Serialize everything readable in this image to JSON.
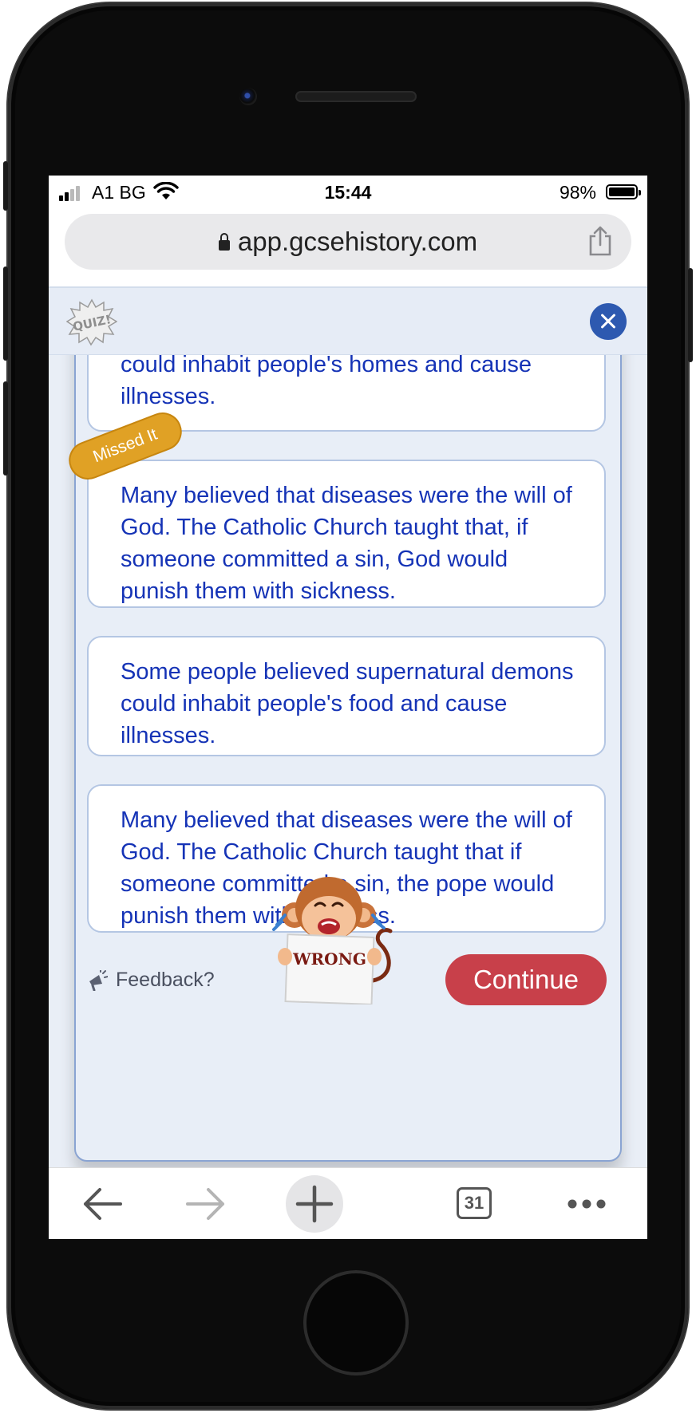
{
  "status_bar": {
    "carrier": "A1 BG",
    "time": "15:44",
    "battery": "98%"
  },
  "browser": {
    "url": "app.gcsehistory.com",
    "tab_count": "31"
  },
  "quiz": {
    "logo_text": "QUIZ!",
    "answers": [
      {
        "text": "Some people believed supernatural demons could inhabit people's homes and cause illnesses."
      },
      {
        "text": "Many believed that diseases were the will of God. The Catholic Church taught that, if someone committed a sin, God would punish them with sickness.",
        "badge": "Missed It"
      },
      {
        "text": "Some people believed supernatural demons could inhabit people's food and cause illnesses."
      },
      {
        "text": "Many believed that diseases were the will of God. The Catholic Church taught that if someone committed a sin, the pope would punish them with sickness."
      }
    ],
    "feedback_label": "Feedback?",
    "continue_label": "Continue",
    "result_sign": "WRONG"
  },
  "colors": {
    "answer_text": "#1533b6",
    "badge": "#e0a125",
    "continue": "#c8404a",
    "close": "#2d59b0"
  }
}
